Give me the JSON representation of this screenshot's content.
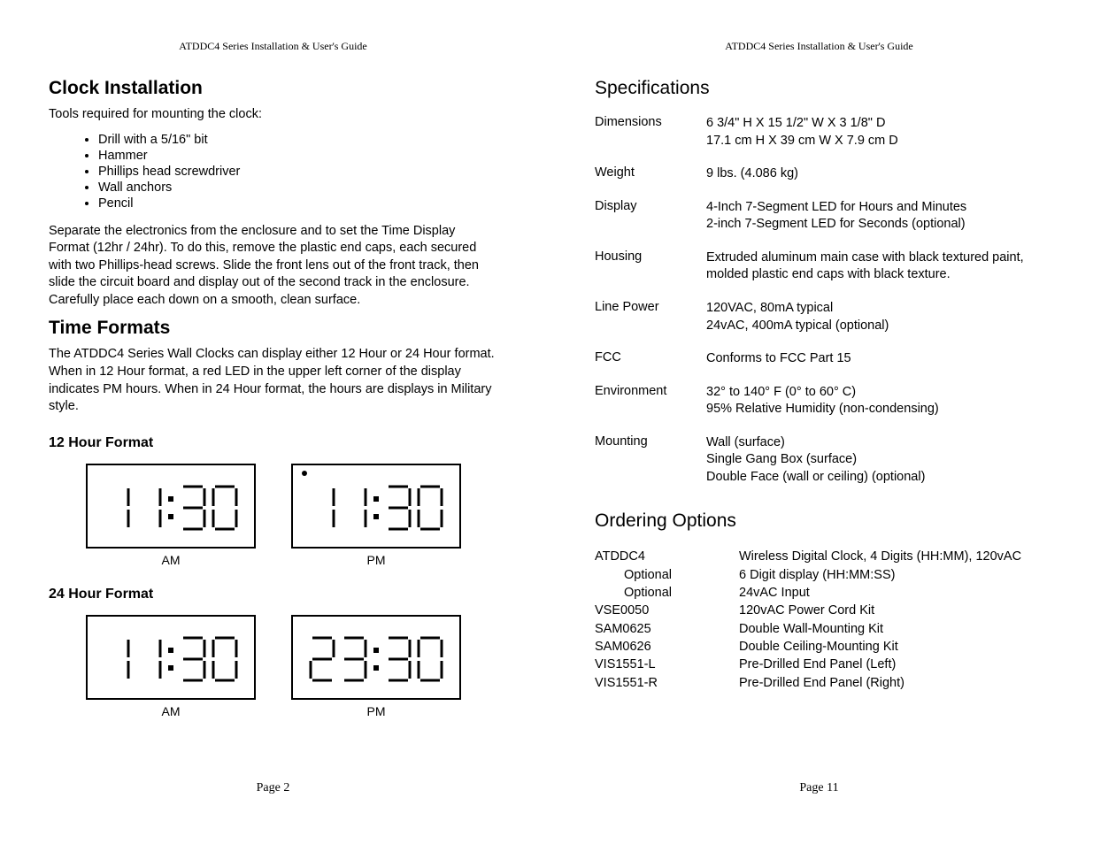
{
  "guide_title": "ATDDC4 Series Installation & User's Guide",
  "left": {
    "h_install": "Clock Installation",
    "tools_intro": "Tools required for mounting the clock:",
    "tools": [
      "Drill with a 5/16\" bit",
      "Hammer",
      "Phillips head screwdriver",
      "Wall anchors",
      "Pencil"
    ],
    "separate_para": "Separate the electronics from the enclosure and to set the Time Display Format (12hr / 24hr). To do this, remove the plastic end caps, each secured with two Phillips-head screws. Slide the front lens out of the front track, then slide the circuit board and display out of the second track in the enclosure. Carefully place each down on a smooth, clean surface.",
    "h_time": "Time Formats",
    "time_para": "The ATDDC4 Series Wall Clocks can display either 12 Hour or 24 Hour format. When in 12 Hour format, a red LED in the upper left corner of the display indicates PM hours. When in 24 Hour format, the hours are displays in Military style.",
    "h_12": "12 Hour Format",
    "h_24": "24 Hour Format",
    "clocks_12": [
      {
        "digits": "1130",
        "pm": false,
        "caption": "AM"
      },
      {
        "digits": "1130",
        "pm": true,
        "caption": "PM"
      }
    ],
    "clocks_24": [
      {
        "digits": "1130",
        "pm": false,
        "caption": "AM"
      },
      {
        "digits": "2330",
        "pm": false,
        "caption": "PM"
      }
    ],
    "page_num": "Page 2"
  },
  "right": {
    "h_spec": "Specifications",
    "specs": [
      {
        "label": "Dimensions",
        "value": "6 3/4\" H X 15 1/2\" W X 3 1/8\" D\n17.1 cm H X 39 cm W X 7.9 cm D"
      },
      {
        "label": "Weight",
        "value": "9 lbs. (4.086 kg)"
      },
      {
        "label": "Display",
        "value": "4-Inch 7-Segment LED for Hours and Minutes\n2-inch 7-Segment LED for Seconds (optional)"
      },
      {
        "label": "Housing",
        "value": "Extruded aluminum main case with black textured paint, molded plastic end caps with black texture."
      },
      {
        "label": "Line Power",
        "value": "120VAC, 80mA typical\n24vAC, 400mA typical (optional)"
      },
      {
        "label": "FCC",
        "value": "Conforms to FCC Part 15"
      },
      {
        "label": "Environment",
        "value": "32° to 140° F (0° to 60° C)\n95% Relative Humidity (non-condensing)"
      },
      {
        "label": "Mounting",
        "value": "Wall (surface)\nSingle Gang Box (surface)\nDouble Face (wall or ceiling) (optional)"
      }
    ],
    "h_order": "Ordering Options",
    "orders": [
      {
        "label": "ATDDC4",
        "indent": false,
        "value": "Wireless Digital Clock, 4 Digits (HH:MM), 120vAC"
      },
      {
        "label": "Optional",
        "indent": true,
        "value": "6 Digit display (HH:MM:SS)"
      },
      {
        "label": "Optional",
        "indent": true,
        "value": "24vAC Input"
      },
      {
        "label": "VSE0050",
        "indent": false,
        "value": "120vAC Power Cord Kit"
      },
      {
        "label": "SAM0625",
        "indent": false,
        "value": "Double Wall-Mounting Kit"
      },
      {
        "label": "SAM0626",
        "indent": false,
        "value": "Double Ceiling-Mounting Kit"
      },
      {
        "label": "VIS1551-L",
        "indent": false,
        "value": "Pre-Drilled End Panel (Left)"
      },
      {
        "label": "VIS1551-R",
        "indent": false,
        "value": "Pre-Drilled End Panel (Right)"
      }
    ],
    "page_num": "Page 11"
  }
}
